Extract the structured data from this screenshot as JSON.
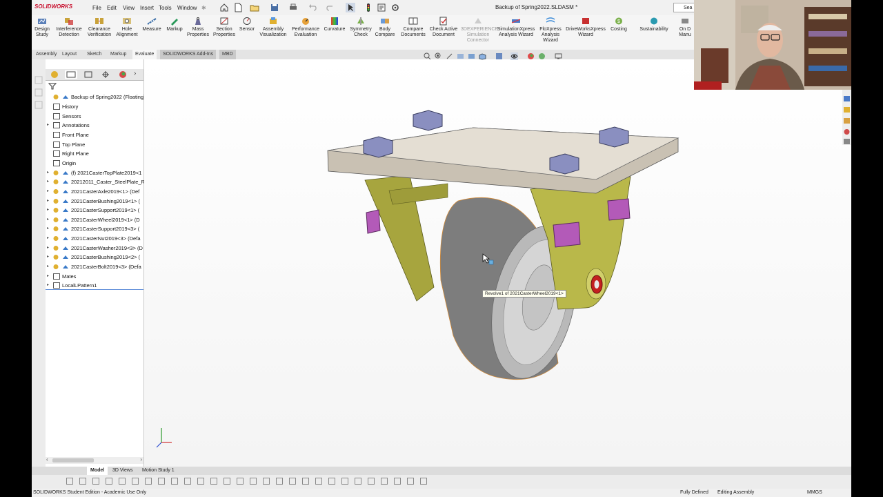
{
  "app": {
    "brand": "SOLIDWORKS",
    "menus": [
      "File",
      "Edit",
      "View",
      "Insert",
      "Tools",
      "Window"
    ],
    "document_title": "Backup of Spring2022.SLDASM *",
    "search_text": "Sea"
  },
  "ribbon": {
    "buttons": [
      {
        "label": "Design Study",
        "icon": "design-study-icon"
      },
      {
        "label": "Interference Detection",
        "icon": "interference-icon"
      },
      {
        "label": "Clearance Verification",
        "icon": "clearance-icon"
      },
      {
        "label": "Hole Alignment",
        "icon": "hole-alignment-icon"
      },
      {
        "label": "Measure",
        "icon": "measure-icon"
      },
      {
        "label": "Markup",
        "icon": "markup-icon"
      },
      {
        "label": "Mass Properties",
        "icon": "mass-properties-icon"
      },
      {
        "label": "Section Properties",
        "icon": "section-properties-icon"
      },
      {
        "label": "Sensor",
        "icon": "sensor-icon"
      },
      {
        "label": "Assembly Visualization",
        "icon": "assembly-visualization-icon"
      },
      {
        "label": "Performance Evaluation",
        "icon": "performance-icon"
      },
      {
        "label": "Curvature",
        "icon": "curvature-icon"
      },
      {
        "label": "Symmetry Check",
        "icon": "symmetry-icon"
      },
      {
        "label": "Body Compare",
        "icon": "body-compare-icon"
      },
      {
        "label": "Compare Documents",
        "icon": "compare-documents-icon"
      },
      {
        "label": "Check Active Document",
        "icon": "check-document-icon"
      },
      {
        "label": "3DEXPERIENCE Simulation Connector",
        "icon": "3dexperience-icon",
        "disabled": true
      },
      {
        "label": "SimulationXpress Analysis Wizard",
        "icon": "simulationxpress-icon"
      },
      {
        "label": "FloXpress Analysis Wizard",
        "icon": "floxpress-icon"
      },
      {
        "label": "DriveWorksXpress Wizard",
        "icon": "driveworks-icon"
      },
      {
        "label": "Costing",
        "icon": "costing-icon"
      },
      {
        "label": "Sustainability",
        "icon": "sustainability-icon"
      },
      {
        "label": "On D Manu",
        "icon": "on-demand-icon"
      }
    ]
  },
  "tabs": [
    "Assembly",
    "Layout",
    "Sketch",
    "Markup",
    "Evaluate",
    "SOLIDWORKS Add-Ins",
    "MBD"
  ],
  "active_tab": "Evaluate",
  "tree": {
    "root": "Backup of Spring2022 (Floating) <",
    "items": [
      {
        "label": "History",
        "icon": "history-icon",
        "expandable": false
      },
      {
        "label": "Sensors",
        "icon": "sensors-icon",
        "expandable": false
      },
      {
        "label": "Annotations",
        "icon": "annotations-icon",
        "expandable": true
      },
      {
        "label": "Front Plane",
        "icon": "plane-icon",
        "expandable": false
      },
      {
        "label": "Top Plane",
        "icon": "plane-icon",
        "expandable": false
      },
      {
        "label": "Right Plane",
        "icon": "plane-icon",
        "expandable": false
      },
      {
        "label": "Origin",
        "icon": "origin-icon",
        "expandable": false
      },
      {
        "label": "(f) 2021CasterTopPlate2019<1",
        "icon": "part-icon",
        "expandable": true
      },
      {
        "label": "20212011_Caster_SteelPlate_R",
        "icon": "part-icon",
        "expandable": true
      },
      {
        "label": "2021CasterAxle2019<1> (Def",
        "icon": "part-icon",
        "expandable": true
      },
      {
        "label": "2021CasterBushing2019<1> (",
        "icon": "part-icon",
        "expandable": true
      },
      {
        "label": "2021CasterSupport2019<1> (",
        "icon": "part-icon",
        "expandable": true
      },
      {
        "label": "2021CasterWheel2019<1> (D",
        "icon": "part-icon",
        "expandable": true
      },
      {
        "label": "2021CasterSupport2019<3> (",
        "icon": "part-icon",
        "expandable": true
      },
      {
        "label": "2021CasterNut2019<3> (Defa",
        "icon": "part-icon",
        "expandable": true
      },
      {
        "label": "2021CasterWasher2019<3> (D",
        "icon": "part-icon",
        "expandable": true
      },
      {
        "label": "2021CasterBushing2019<2> (",
        "icon": "part-icon",
        "expandable": true
      },
      {
        "label": "2021CasterBolt2019<3> (Defa",
        "icon": "part-icon",
        "expandable": true
      },
      {
        "label": "Mates",
        "icon": "mates-icon",
        "expandable": true
      },
      {
        "label": "LocalLPattern1",
        "icon": "pattern-icon",
        "expandable": true
      }
    ]
  },
  "viewport": {
    "tooltip": "Revolve1 of 2021CasterWheel2019<1>"
  },
  "bottom_tabs": [
    "Model",
    "3D Views",
    "Motion Study 1"
  ],
  "active_bottom_tab": "Model",
  "status": {
    "left": "SOLIDWORKS Student Edition - Academic Use Only",
    "defined": "Fully Defined",
    "mode": "Editing Assembly",
    "units": "MMGS"
  },
  "colors": {
    "plate": "#e4ded3",
    "bolt_head": "#8a8fc0",
    "nut": "#b35ab8",
    "support": "#b9b84a",
    "wheel": "#7d7d7d",
    "hub": "#cfcfcf",
    "bushing": "#c32020",
    "brand_red": "#c8102e"
  }
}
